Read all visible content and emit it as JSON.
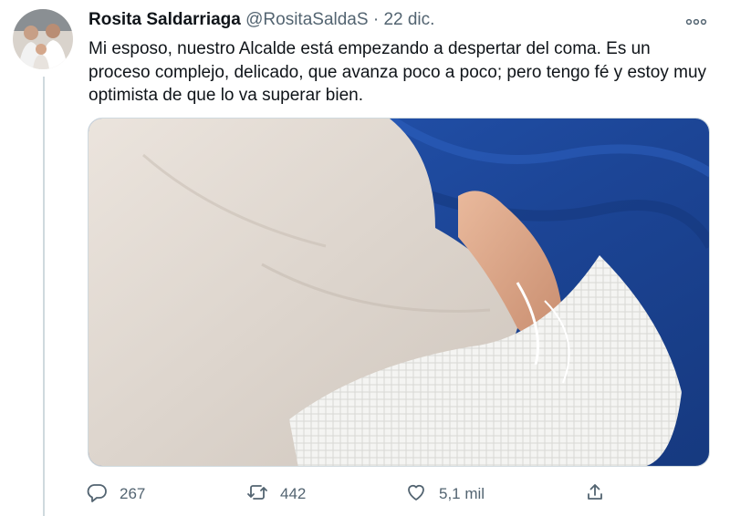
{
  "tweet": {
    "author": {
      "display_name": "Rosita Saldarriaga",
      "handle": "@RositaSaldaS",
      "separator": "·",
      "date": "22 dic."
    },
    "text": "Mi esposo, nuestro Alcalde está empezando a despertar del coma. Es un proceso complejo, delicado, que avanza poco a poco; pero tengo fé y estoy muy optimista de que lo va superar bien.",
    "media_icon": "photo",
    "actions": {
      "reply": {
        "icon": "reply-icon",
        "count": "267"
      },
      "retweet": {
        "icon": "retweet-icon",
        "count": "442"
      },
      "like": {
        "icon": "heart-icon",
        "count": "5,1 mil"
      },
      "share": {
        "icon": "share-icon"
      }
    }
  },
  "colors": {
    "text": "#0f1419",
    "secondary": "#536471",
    "border": "#cfd9de",
    "blanket": "#1f4a9e"
  }
}
